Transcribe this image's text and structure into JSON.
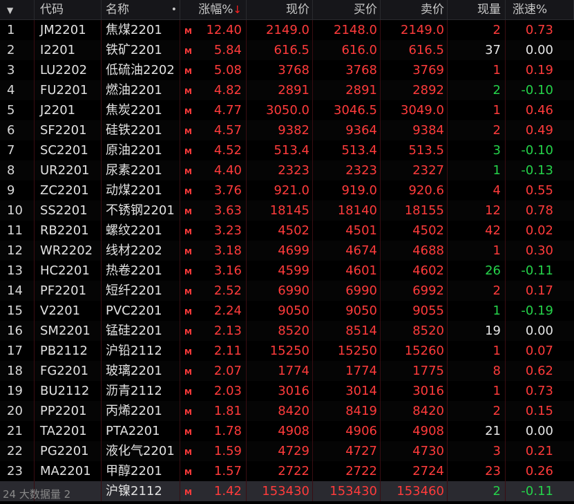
{
  "header": {
    "menu_caret": "▼",
    "code": "代码",
    "name": "名称",
    "name_dot": "•",
    "change_pct": "涨幅%",
    "sort_arrow": "↓",
    "price": "现价",
    "bid": "买价",
    "ask": "卖价",
    "volume": "现量",
    "speed": "涨速%"
  },
  "flag_text": "M",
  "overlay_text": "24 大数据量 2",
  "colors": {
    "up": "#ff3b3b",
    "down": "#25d34a",
    "neutral": "#e6e6e6"
  },
  "rows": [
    {
      "idx": "1",
      "code": "JM2201",
      "name": "焦煤2201",
      "chg": "12.40",
      "price": "2149.0",
      "bid": "2148.0",
      "ask": "2149.0",
      "vol": "2",
      "speed": "0.73",
      "speed_dir": "up"
    },
    {
      "idx": "2",
      "code": "I2201",
      "name": "铁矿2201",
      "chg": "5.84",
      "price": "616.5",
      "bid": "616.0",
      "ask": "616.5",
      "vol": "37",
      "speed": "0.00",
      "speed_dir": "flat"
    },
    {
      "idx": "3",
      "code": "LU2202",
      "name": "低硫油2202",
      "chg": "5.08",
      "price": "3768",
      "bid": "3768",
      "ask": "3769",
      "vol": "1",
      "speed": "0.19",
      "speed_dir": "up"
    },
    {
      "idx": "4",
      "code": "FU2201",
      "name": "燃油2201",
      "chg": "4.82",
      "price": "2891",
      "bid": "2891",
      "ask": "2892",
      "vol": "2",
      "speed": "-0.10",
      "speed_dir": "down"
    },
    {
      "idx": "5",
      "code": "J2201",
      "name": "焦炭2201",
      "chg": "4.77",
      "price": "3050.0",
      "bid": "3046.5",
      "ask": "3049.0",
      "vol": "1",
      "speed": "0.46",
      "speed_dir": "up"
    },
    {
      "idx": "6",
      "code": "SF2201",
      "name": "硅铁2201",
      "chg": "4.57",
      "price": "9382",
      "bid": "9364",
      "ask": "9384",
      "vol": "2",
      "speed": "0.49",
      "speed_dir": "up"
    },
    {
      "idx": "7",
      "code": "SC2201",
      "name": "原油2201",
      "chg": "4.52",
      "price": "513.4",
      "bid": "513.4",
      "ask": "513.5",
      "vol": "3",
      "speed": "-0.10",
      "speed_dir": "down"
    },
    {
      "idx": "8",
      "code": "UR2201",
      "name": "尿素2201",
      "chg": "4.40",
      "price": "2323",
      "bid": "2323",
      "ask": "2327",
      "vol": "1",
      "speed": "-0.13",
      "speed_dir": "down"
    },
    {
      "idx": "9",
      "code": "ZC2201",
      "name": "动煤2201",
      "chg": "3.76",
      "price": "921.0",
      "bid": "919.0",
      "ask": "920.6",
      "vol": "4",
      "speed": "0.55",
      "speed_dir": "up"
    },
    {
      "idx": "10",
      "code": "SS2201",
      "name": "不锈钢2201",
      "chg": "3.63",
      "price": "18145",
      "bid": "18140",
      "ask": "18155",
      "vol": "12",
      "speed": "0.78",
      "speed_dir": "up"
    },
    {
      "idx": "11",
      "code": "RB2201",
      "name": "螺纹2201",
      "chg": "3.23",
      "price": "4502",
      "bid": "4501",
      "ask": "4502",
      "vol": "42",
      "speed": "0.02",
      "speed_dir": "up"
    },
    {
      "idx": "12",
      "code": "WR2202",
      "name": "线材2202",
      "chg": "3.18",
      "price": "4699",
      "bid": "4674",
      "ask": "4688",
      "vol": "1",
      "speed": "0.30",
      "speed_dir": "up"
    },
    {
      "idx": "13",
      "code": "HC2201",
      "name": "热卷2201",
      "chg": "3.16",
      "price": "4599",
      "bid": "4601",
      "ask": "4602",
      "vol": "26",
      "speed": "-0.11",
      "speed_dir": "down"
    },
    {
      "idx": "14",
      "code": "PF2201",
      "name": "短纤2201",
      "chg": "2.52",
      "price": "6990",
      "bid": "6990",
      "ask": "6992",
      "vol": "2",
      "speed": "0.17",
      "speed_dir": "up"
    },
    {
      "idx": "15",
      "code": "V2201",
      "name": "PVC2201",
      "chg": "2.24",
      "price": "9050",
      "bid": "9050",
      "ask": "9055",
      "vol": "1",
      "speed": "-0.19",
      "speed_dir": "down"
    },
    {
      "idx": "16",
      "code": "SM2201",
      "name": "锰硅2201",
      "chg": "2.13",
      "price": "8520",
      "bid": "8514",
      "ask": "8520",
      "vol": "19",
      "speed": "0.00",
      "speed_dir": "flat"
    },
    {
      "idx": "17",
      "code": "PB2112",
      "name": "沪铅2112",
      "chg": "2.11",
      "price": "15250",
      "bid": "15250",
      "ask": "15260",
      "vol": "1",
      "speed": "0.07",
      "speed_dir": "up"
    },
    {
      "idx": "18",
      "code": "FG2201",
      "name": "玻璃2201",
      "chg": "2.07",
      "price": "1774",
      "bid": "1774",
      "ask": "1775",
      "vol": "8",
      "speed": "0.62",
      "speed_dir": "up"
    },
    {
      "idx": "19",
      "code": "BU2112",
      "name": "沥青2112",
      "chg": "2.03",
      "price": "3016",
      "bid": "3014",
      "ask": "3016",
      "vol": "1",
      "speed": "0.73",
      "speed_dir": "up"
    },
    {
      "idx": "20",
      "code": "PP2201",
      "name": "丙烯2201",
      "chg": "1.81",
      "price": "8420",
      "bid": "8419",
      "ask": "8420",
      "vol": "2",
      "speed": "0.15",
      "speed_dir": "up"
    },
    {
      "idx": "21",
      "code": "TA2201",
      "name": "PTA2201",
      "chg": "1.78",
      "price": "4908",
      "bid": "4906",
      "ask": "4908",
      "vol": "21",
      "speed": "0.00",
      "speed_dir": "flat"
    },
    {
      "idx": "22",
      "code": "PG2201",
      "name": "液化气2201",
      "chg": "1.59",
      "price": "4729",
      "bid": "4727",
      "ask": "4730",
      "vol": "3",
      "speed": "0.21",
      "speed_dir": "up"
    },
    {
      "idx": "23",
      "code": "MA2201",
      "name": "甲醇2201",
      "chg": "1.57",
      "price": "2722",
      "bid": "2722",
      "ask": "2724",
      "vol": "23",
      "speed": "0.26",
      "speed_dir": "up"
    },
    {
      "idx": "",
      "code": "",
      "name": "沪镍2112",
      "chg": "1.42",
      "price": "153430",
      "bid": "153430",
      "ask": "153460",
      "vol": "2",
      "speed": "-0.11",
      "speed_dir": "down"
    }
  ]
}
